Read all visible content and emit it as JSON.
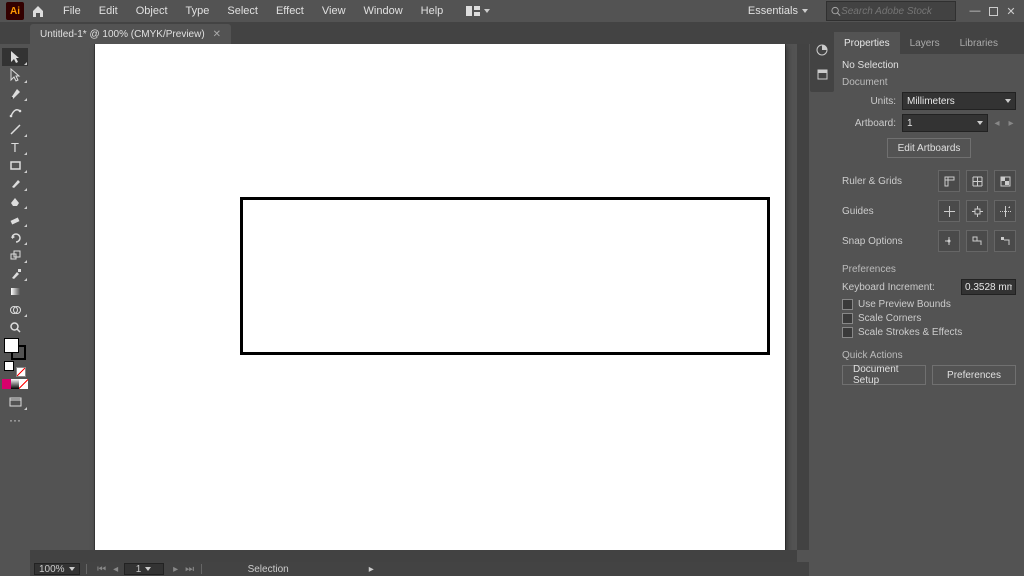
{
  "app": {
    "logo": "Ai"
  },
  "menu": [
    "File",
    "Edit",
    "Object",
    "Type",
    "Select",
    "Effect",
    "View",
    "Window",
    "Help"
  ],
  "workspace": "Essentials",
  "search": {
    "placeholder": "Search Adobe Stock"
  },
  "tab": {
    "title": "Untitled-1* @ 100% (CMYK/Preview)"
  },
  "panel": {
    "tabs": [
      "Properties",
      "Layers",
      "Libraries"
    ],
    "active": 0,
    "selection": "No Selection",
    "doc_section": "Document",
    "units": {
      "label": "Units:",
      "value": "Millimeters"
    },
    "artboard": {
      "label": "Artboard:",
      "value": "1"
    },
    "edit_artboards": "Edit Artboards",
    "ruler_grids": "Ruler & Grids",
    "guides": "Guides",
    "snap": "Snap Options",
    "prefs_section": "Preferences",
    "kb_inc": {
      "label": "Keyboard Increment:",
      "value": "0.3528 mm"
    },
    "checks": [
      "Use Preview Bounds",
      "Scale Corners",
      "Scale Strokes & Effects"
    ],
    "quick": "Quick Actions",
    "btn_docsetup": "Document Setup",
    "btn_prefs": "Preferences"
  },
  "status": {
    "zoom": "100%",
    "art": "1",
    "tool": "Selection"
  }
}
